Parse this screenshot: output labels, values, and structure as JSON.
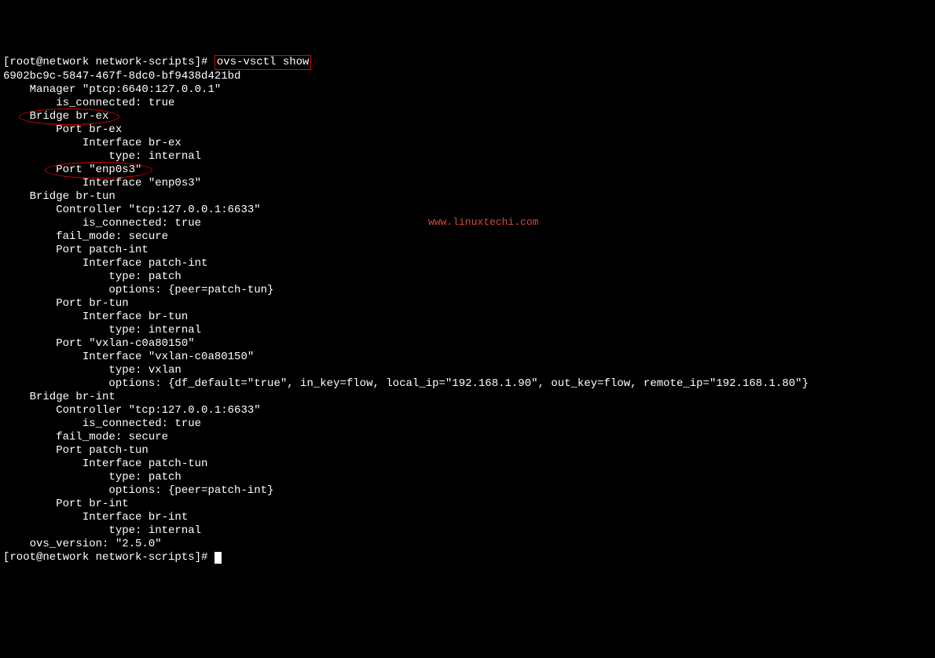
{
  "prompt1": "[root@network network-scripts]# ",
  "command": "ovs-vsctl show",
  "uuid": "6902bc9c-5847-467f-8dc0-bf9438d421bd",
  "l_manager": "    Manager \"ptcp:6640:127.0.0.1\"",
  "l_manager_conn": "        is_connected: true",
  "l_bridge_brex_prefix": "    ",
  "l_bridge_brex": "Bridge br-ex",
  "l_port_brex": "        Port br-ex",
  "l_iface_brex": "            Interface br-ex",
  "l_type_internal1": "                type: internal",
  "l_port_enp_prefix": "        ",
  "l_port_enp": "Port \"enp0s3\"",
  "l_iface_enp": "            Interface \"enp0s3\"",
  "l_bridge_brtun": "    Bridge br-tun",
  "l_ctrl_brtun": "        Controller \"tcp:127.0.0.1:6633\"",
  "l_ctrl_brtun_conn": "            is_connected: true",
  "l_fail_brtun": "        fail_mode: secure",
  "l_port_patchint": "        Port patch-int",
  "l_iface_patchint": "            Interface patch-int",
  "l_type_patch1": "                type: patch",
  "l_opts_patchtun": "                options: {peer=patch-tun}",
  "l_port_brtun": "        Port br-tun",
  "l_iface_brtun": "            Interface br-tun",
  "l_type_internal2": "                type: internal",
  "l_port_vxlan": "        Port \"vxlan-c0a80150\"",
  "l_iface_vxlan": "            Interface \"vxlan-c0a80150\"",
  "l_type_vxlan": "                type: vxlan",
  "l_opts_vxlan": "                options: {df_default=\"true\", in_key=flow, local_ip=\"192.168.1.90\", out_key=flow, remote_ip=\"192.168.1.80\"}",
  "l_bridge_brint": "    Bridge br-int",
  "l_ctrl_brint": "        Controller \"tcp:127.0.0.1:6633\"",
  "l_ctrl_brint_conn": "            is_connected: true",
  "l_fail_brint": "        fail_mode: secure",
  "l_port_patchtun": "        Port patch-tun",
  "l_iface_patchtun": "            Interface patch-tun",
  "l_type_patch2": "                type: patch",
  "l_opts_patchint": "                options: {peer=patch-int}",
  "l_port_brint": "        Port br-int",
  "l_iface_brint": "            Interface br-int",
  "l_type_internal3": "                type: internal",
  "l_ovs_version": "    ovs_version: \"2.5.0\"",
  "prompt2": "[root@network network-scripts]# ",
  "watermark": "www.linuxtechi.com"
}
